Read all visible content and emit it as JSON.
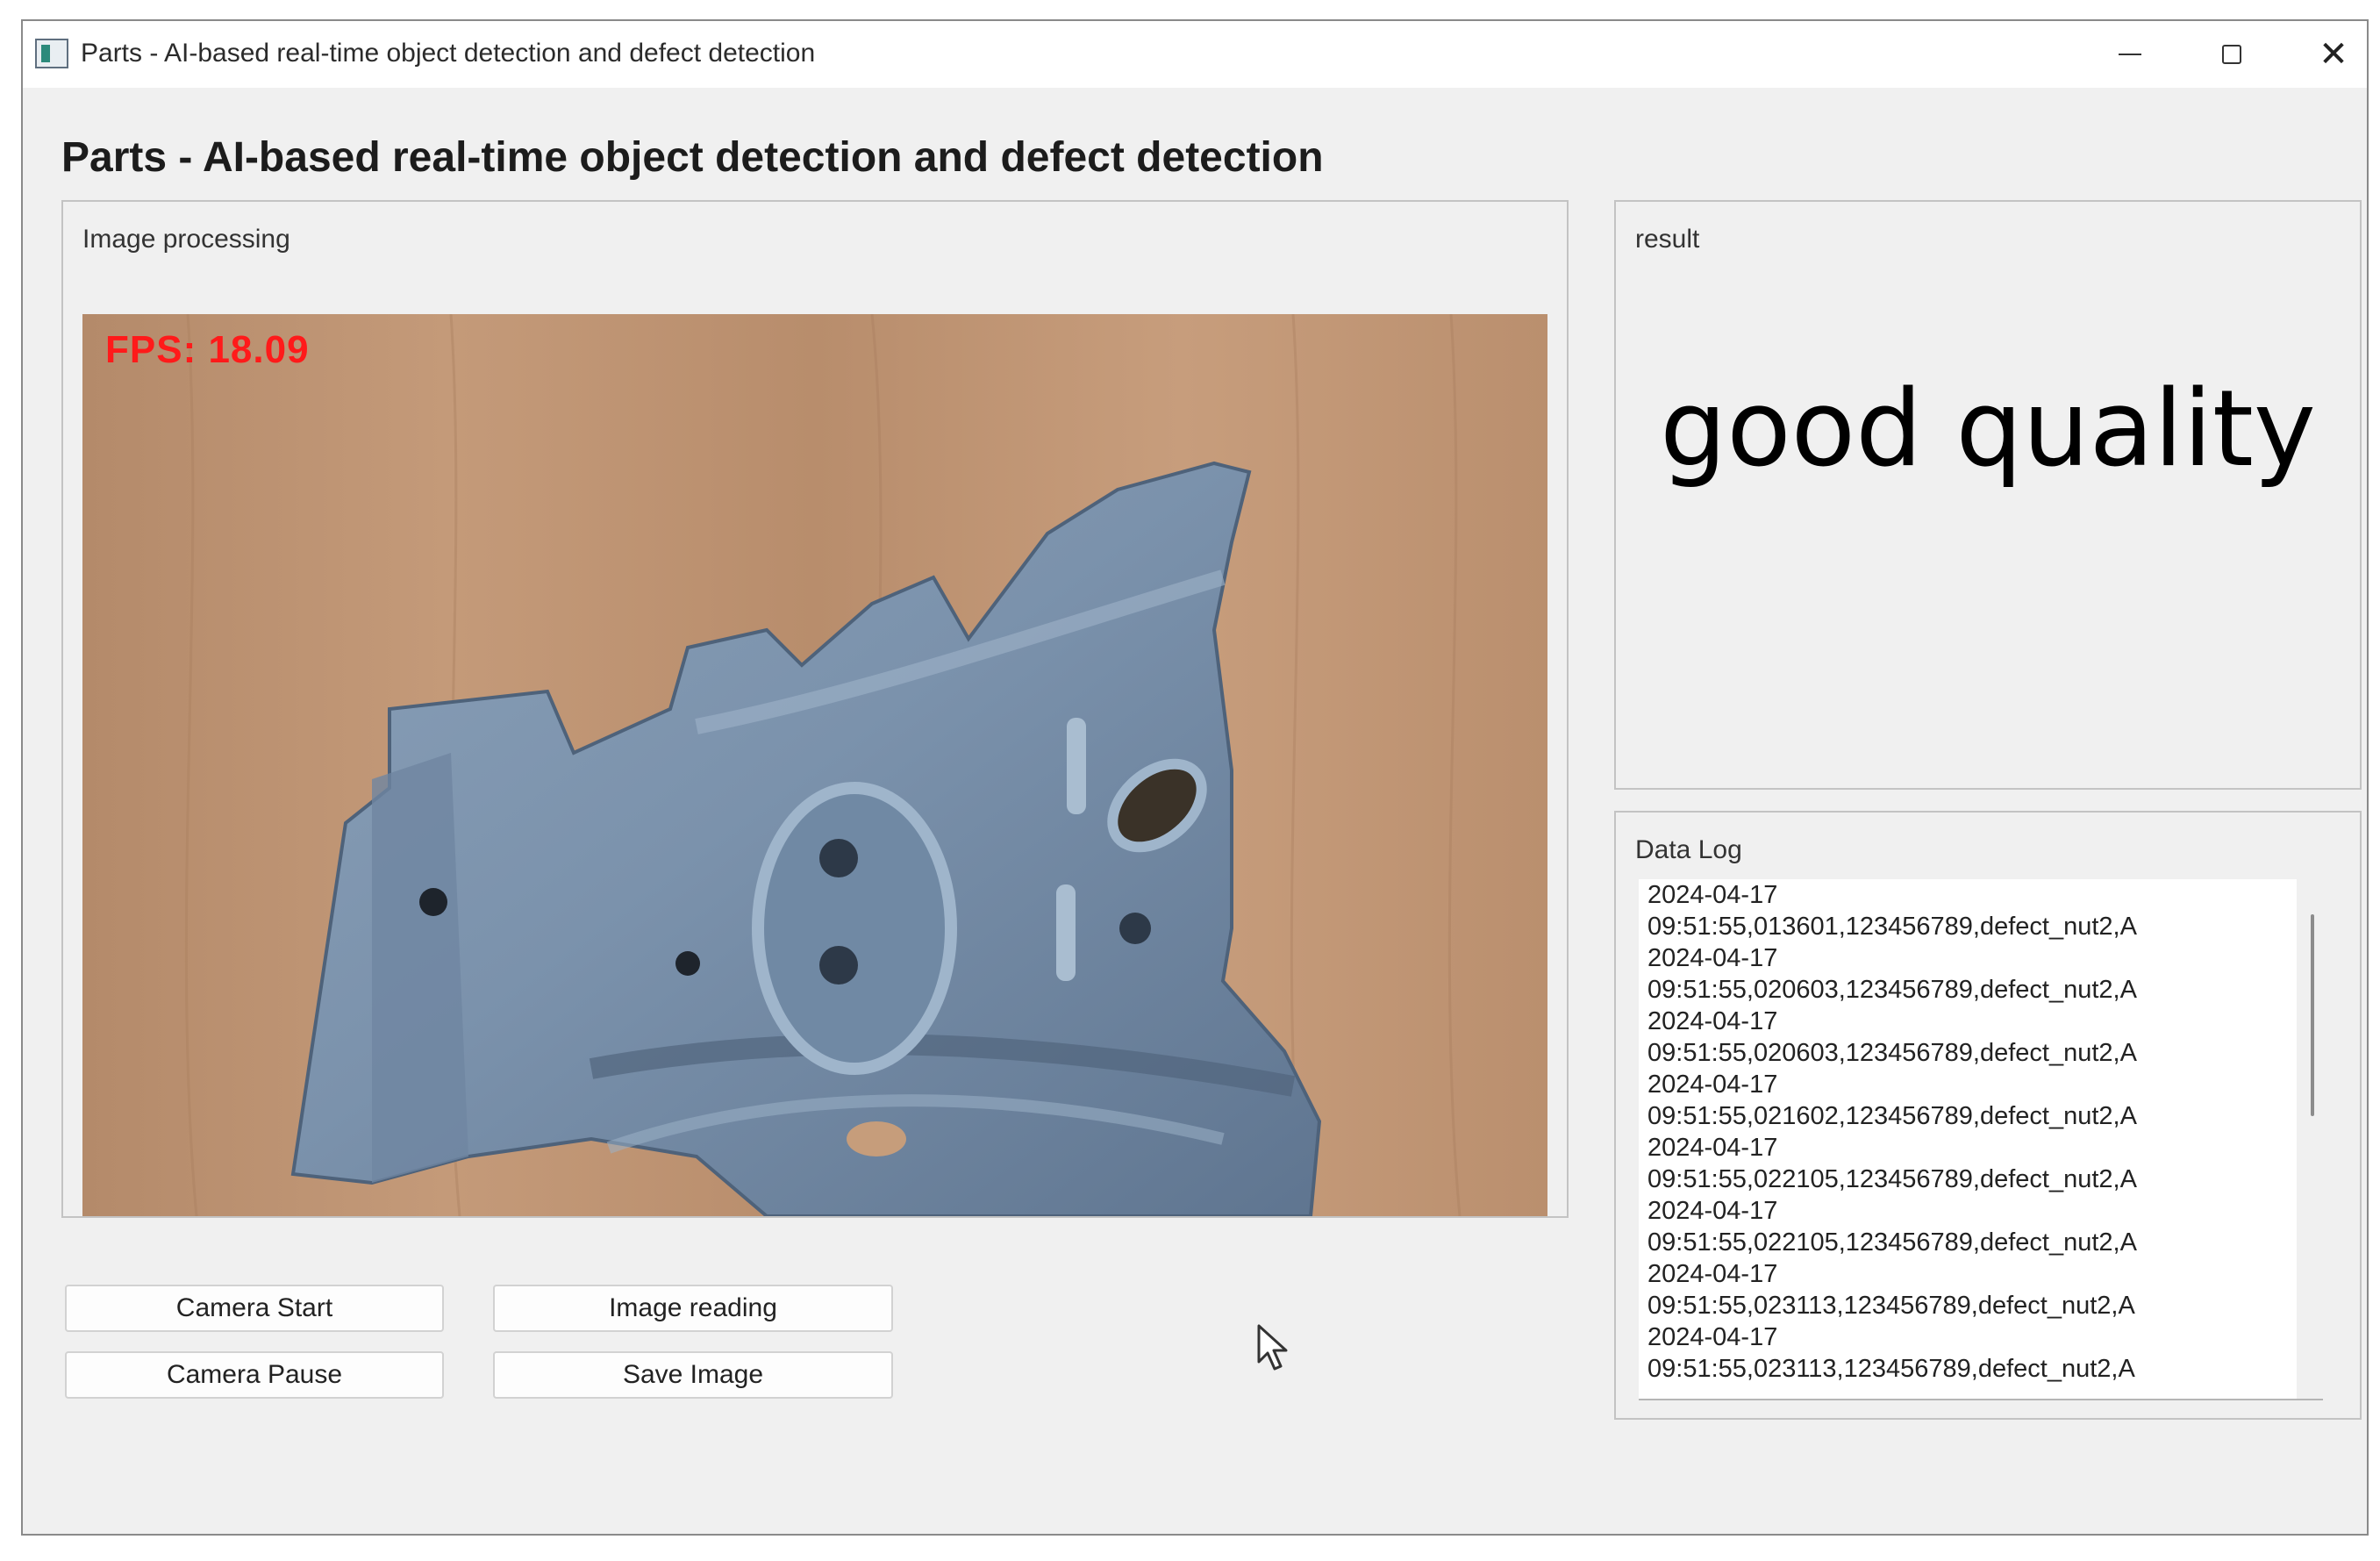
{
  "window": {
    "title": "Parts - AI-based real-time object detection and defect detection",
    "controls": {
      "minimize_icon": "minimize-icon",
      "maximize_icon": "maximize-icon",
      "close_icon": "close-icon",
      "close_glyph": "✕"
    }
  },
  "heading": "Parts - AI-based real-time object detection and defect detection",
  "image_panel": {
    "label": "Image processing",
    "fps_overlay": "FPS:  18.09"
  },
  "result_panel": {
    "label": "result",
    "value": "good quality"
  },
  "log_panel": {
    "label": "Data Log",
    "lines": [
      "2024-04-17",
      "09:51:55,013601,123456789,defect_nut2,A",
      "2024-04-17",
      "09:51:55,020603,123456789,defect_nut2,A",
      "2024-04-17",
      "09:51:55,020603,123456789,defect_nut2,A",
      "2024-04-17",
      "09:51:55,021602,123456789,defect_nut2,A",
      "2024-04-17",
      "09:51:55,022105,123456789,defect_nut2,A",
      "2024-04-17",
      "09:51:55,022105,123456789,defect_nut2,A",
      "2024-04-17",
      "09:51:55,023113,123456789,defect_nut2,A",
      "2024-04-17",
      "09:51:55,023113,123456789,defect_nut2,A"
    ]
  },
  "buttons": {
    "camera_start": "Camera Start",
    "camera_pause": "Camera Pause",
    "image_reading": "Image reading",
    "save_image": "Save Image"
  },
  "colors": {
    "fps_text": "#ff1a1a",
    "part_metal": "#7d93ad",
    "wood_background": "#bf9473"
  }
}
